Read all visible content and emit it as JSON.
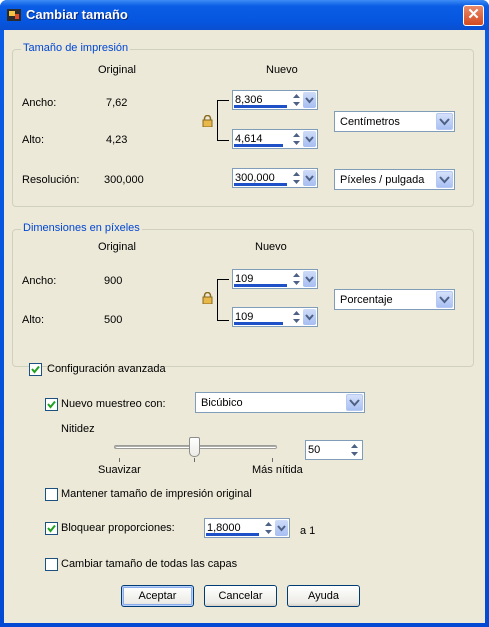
{
  "window": {
    "title": "Cambiar tamaño",
    "close_glyph": "✕"
  },
  "print_size": {
    "legend": "Tamaño de impresión",
    "col_original": "Original",
    "col_new": "Nuevo",
    "width_label": "Ancho:",
    "width_original": "7,62",
    "width_new": "8,306",
    "height_label": "Alto:",
    "height_original": "4,23",
    "height_new": "4,614",
    "resolution_label": "Resolución:",
    "resolution_original": "300,000",
    "resolution_new": "300,000",
    "units": "Centímetros",
    "resolution_units": "Píxeles / pulgada"
  },
  "pixel_dims": {
    "legend": "Dimensiones en píxeles",
    "col_original": "Original",
    "col_new": "Nuevo",
    "width_label": "Ancho:",
    "width_original": "900",
    "width_new": "109",
    "height_label": "Alto:",
    "height_original": "500",
    "height_new": "109",
    "units": "Porcentaje"
  },
  "advanced": {
    "label": "Configuración avanzada",
    "checked": true,
    "resample_label": "Nuevo muestreo con:",
    "resample_checked": true,
    "resample_method": "Bicúbico",
    "sharpness_label": "Nitidez",
    "sharpness_value": "50",
    "sharpness_min_label": "Suavizar",
    "sharpness_max_label": "Más nítida",
    "sharpness_level": 0.5
  },
  "keep_print_size": {
    "label": "Mantener tamaño de impresión original",
    "checked": false
  },
  "lock_ratio": {
    "label": "Bloquear proporciones:",
    "checked": true,
    "value": "1,8000",
    "suffix": "a 1"
  },
  "resize_all_layers": {
    "label": "Cambiar tamaño de todas las capas",
    "checked": false
  },
  "buttons": {
    "ok": "Aceptar",
    "cancel": "Cancelar",
    "help": "Ayuda"
  },
  "colors": {
    "title_blue": "#0656e0",
    "group_legend": "#0046d5",
    "dialog_bg": "#ece9d8",
    "check": "#21a121"
  }
}
